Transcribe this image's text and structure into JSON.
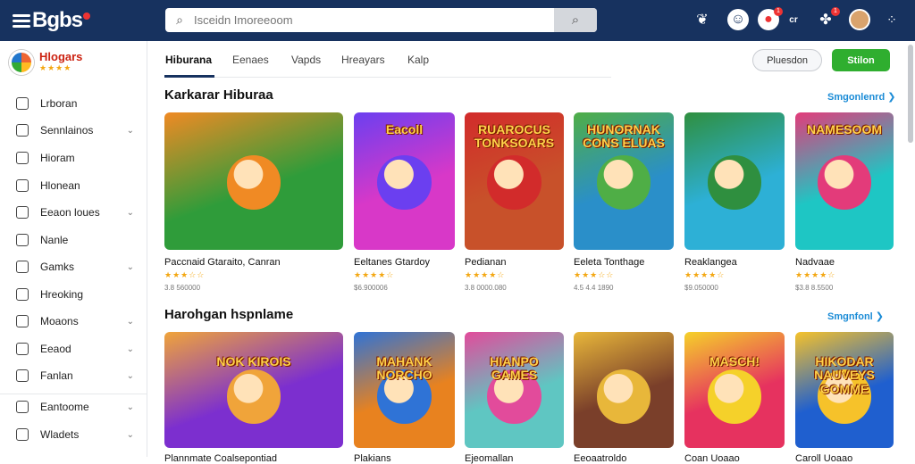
{
  "topbar": {
    "logo_text": "Bgbs",
    "search_placeholder": "Isceidn Imoreeoom",
    "notif_count": "1",
    "cart_count": "1",
    "icons": [
      "spark-icon",
      "avatar-icon",
      "notification-icon",
      "settings-icon",
      "controller-icon",
      "profile-avatar",
      "grid-icon"
    ]
  },
  "sidebar": {
    "brand_name": "Hlogars",
    "brand_stars": "★★★★",
    "items": [
      {
        "label": "Lrboran",
        "chev": false
      },
      {
        "label": "Sennlainos",
        "chev": true
      },
      {
        "label": "Hioram",
        "chev": false
      },
      {
        "label": "Hlonean",
        "chev": false
      },
      {
        "label": "Eeaon loues",
        "chev": true
      },
      {
        "label": "Nanle",
        "chev": false
      },
      {
        "label": "Gamks",
        "chev": true
      },
      {
        "label": "Hreoking",
        "chev": false
      },
      {
        "label": "Moaons",
        "chev": true
      },
      {
        "label": "Eeaod",
        "chev": true
      },
      {
        "label": "Fanlan",
        "chev": true
      },
      {
        "label": "Eantoome",
        "chev": true
      },
      {
        "label": "Wladets",
        "chev": true
      }
    ]
  },
  "tabs": [
    "Hiburana",
    "Eenaes",
    "Vapds",
    "Hreayars",
    "Kalp"
  ],
  "actions": {
    "outline": "Pluesdon",
    "primary": "Stilon"
  },
  "sections": [
    {
      "title": "Karkarar Hiburaa",
      "see_all": "Smgonlenrd ❯",
      "cards": [
        {
          "title": "Paccnaid Gtaraito, Canran",
          "stars": "★★★☆☆",
          "meta": "3.8 560000",
          "label": "",
          "bg": "#2f9c3a",
          "accent": "#f08a24"
        },
        {
          "title": "Eeltanes Gtardoy",
          "stars": "★★★★☆",
          "meta": "$6.900006",
          "label": "Eacoll",
          "bg": "#d838c8",
          "accent": "#6b3ff0"
        },
        {
          "title": "Pedianan",
          "stars": "★★★★☆",
          "meta": "3.8 0000.080",
          "label": "RUAROCUS TONKSOARS",
          "bg": "#c8512a",
          "accent": "#d22b2b"
        },
        {
          "title": "Eeleta Tonthage",
          "stars": "★★★☆☆",
          "meta": "4.5 4.4 1890",
          "label": "HUNORNAK CONS ELUAS",
          "bg": "#2a8fc9",
          "accent": "#4fae46"
        },
        {
          "title": "Reaklangea",
          "stars": "★★★★☆",
          "meta": "$9.050000",
          "label": "",
          "bg": "#2db0d6",
          "accent": "#2f8f3f"
        },
        {
          "title": "Nadvaae",
          "stars": "★★★★☆",
          "meta": "$3.8 8.5500",
          "label": "NAMESOOM",
          "bg": "#1ec6c4",
          "accent": "#e33b7a"
        }
      ]
    },
    {
      "title": "Harohgan hspnlame",
      "see_all": "Smgnfonl ❯",
      "cards": [
        {
          "title": "Plannmate Coalsepontiad",
          "stars": "",
          "meta": "",
          "label": "NOK KIROIS",
          "bg": "#7c2fcf",
          "accent": "#f0a43a"
        },
        {
          "title": "Plakians",
          "stars": "",
          "meta": "",
          "label": "MAHANK NORCHO",
          "bg": "#e8821f",
          "accent": "#2f73d6"
        },
        {
          "title": "Ejeomallan",
          "stars": "",
          "meta": "",
          "label": "HIANPO GAMES",
          "bg": "#5fc6c2",
          "accent": "#e24b9b"
        },
        {
          "title": "Eeoaatroldo",
          "stars": "",
          "meta": "",
          "label": "",
          "bg": "#7a3f2a",
          "accent": "#e8b73a"
        },
        {
          "title": "Coan Uoaao",
          "stars": "",
          "meta": "",
          "label": "MASCH!",
          "bg": "#e6325f",
          "accent": "#f5d12a"
        },
        {
          "title": "Caroll Uoaao",
          "stars": "",
          "meta": "",
          "label": "HIKODAR NAUVEYS GOMME",
          "bg": "#1f5fcf",
          "accent": "#f6c22a"
        }
      ]
    }
  ],
  "colors": {
    "topbar": "#17325f",
    "accent_link": "#1a8bd6",
    "primary_button": "#2fae2f",
    "star": "#f3a712"
  }
}
